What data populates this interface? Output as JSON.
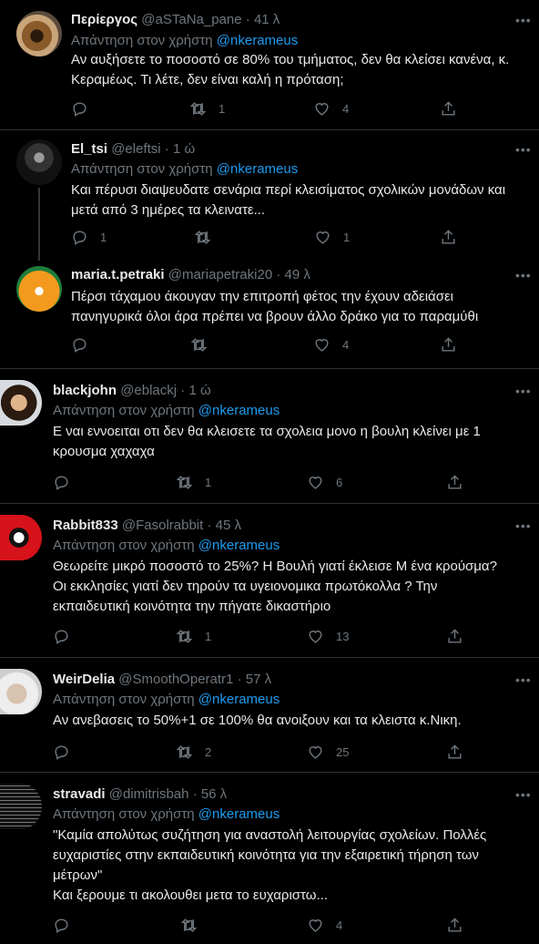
{
  "reply_prefix": "Απάντηση στον χρήστη",
  "tweets": [
    {
      "name": "Περίεργος",
      "handle": "@aSTaNa_pane",
      "time": "41 λ",
      "mention": "@nkerameus",
      "lines": [
        "Αν αυξήσετε το ποσοστό σε 80% του τμήματος, δεν θα κλείσει κανένα, κ.",
        "Κεραμέως. Τι λέτε, δεν είναι καλή η πρόταση;"
      ],
      "replies": "",
      "retweets": "1",
      "likes": "4"
    },
    {
      "name": "El_tsi",
      "handle": "@eleftsi",
      "time": "1 ώ",
      "mention": "@nkerameus",
      "lines": [
        "Και πέρυσι διαψευδατε σενάρια περί κλεισίματος σχολικών μονάδων και",
        "μετά από 3 ημέρες τα κλεινατε..."
      ],
      "replies": "1",
      "retweets": "",
      "likes": "1"
    },
    {
      "name": "maria.t.petraki",
      "handle": "@mariapetraki20",
      "time": "49 λ",
      "mention": "",
      "lines": [
        "Πέρσι τάχαμου άκουγαν την επιτροπή φέτος την έχουν αδειάσει",
        "πανηγυρικά όλοι άρα πρέπει να βρουν άλλο δράκο για το παραμύθι"
      ],
      "replies": "",
      "retweets": "",
      "likes": "4"
    },
    {
      "name": "blackjohn",
      "handle": "@eblackj",
      "time": "1 ώ",
      "mention": "@nkerameus",
      "lines": [
        "Ε ναι εννοειται οτι δεν θα κλεισετε τα σχολεια μονο η βουλη κλείνει με 1",
        "κρουσμα χαχαχα"
      ],
      "replies": "",
      "retweets": "1",
      "likes": "6"
    },
    {
      "name": "Rabbit833",
      "handle": "@Fasolrabbit",
      "time": "45 λ",
      "mention": "@nkerameus",
      "lines": [
        "Θεωρείτε μικρό ποσοστό το 25%? Η Βουλή γιατί έκλεισε Μ ένα κρούσμα?",
        "Οι εκκλησίες γιατί δεν τηρούν τα υγειονομικα πρωτόκολλα ? Την",
        "εκπαιδευτική κοινότητα την πήγατε δικαστήριο"
      ],
      "replies": "",
      "retweets": "1",
      "likes": "13"
    },
    {
      "name": "WeirDelia",
      "handle": "@SmoothOperatr1",
      "time": "57 λ",
      "mention": "@nkerameus",
      "lines": [
        "Αν ανεβασεις το 50%+1 σε 100% θα ανοιξουν και τα κλειστα κ.Νικη."
      ],
      "replies": "",
      "retweets": "2",
      "likes": "25"
    },
    {
      "name": "stravadi",
      "handle": "@dimitrisbah",
      "time": "56 λ",
      "mention": "@nkerameus",
      "lines": [
        "\"Καμία απολύτως συζήτηση για αναστολή λειτουργίας σχολείων. Πολλές",
        "ευχαριστίες στην εκπαιδευτική κοινότητα για την εξαιρετική τήρηση των",
        "μέτρων\"",
        "Και ξερουμε τι ακολουθει μετα το ευχαριστω..."
      ],
      "replies": "",
      "retweets": "",
      "likes": "4"
    }
  ]
}
